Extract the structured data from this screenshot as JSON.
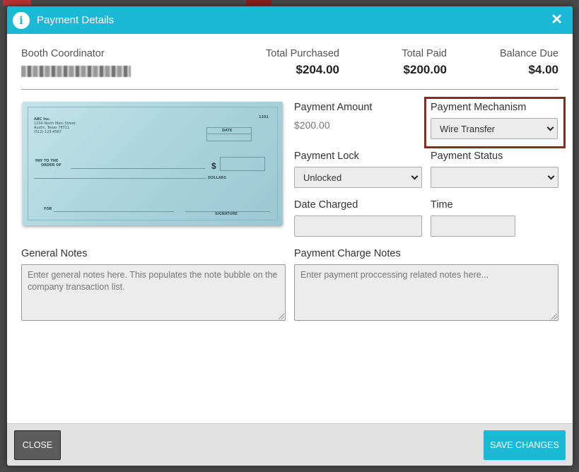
{
  "modal": {
    "title": "Payment Details",
    "close_glyph": "✕"
  },
  "summary": {
    "booth_coordinator_label": "Booth Coordinator",
    "total_purchased_label": "Total Purchased",
    "total_purchased_value": "$204.00",
    "total_paid_label": "Total Paid",
    "total_paid_value": "$200.00",
    "balance_due_label": "Balance Due",
    "balance_due_value": "$4.00"
  },
  "check": {
    "company": "ABC Inc.",
    "address1": "1234 North Main Street",
    "address2": "Austin, Texas 78711",
    "phone": "(512) 123-4567",
    "number": "1201",
    "date_label": "DATE",
    "pay_to_label1": "PAY TO THE",
    "pay_to_label2": "ORDER OF",
    "dollar_sign": "$",
    "dollars_label": "DOLLARS",
    "for_label": "FOR",
    "signature_label": "SIGNATURE"
  },
  "form": {
    "payment_amount_label": "Payment Amount",
    "payment_amount_value": "$200.00",
    "payment_mechanism_label": "Payment Mechanism",
    "payment_mechanism_value": "Wire Transfer",
    "payment_lock_label": "Payment Lock",
    "payment_lock_value": "Unlocked",
    "payment_status_label": "Payment Status",
    "payment_status_value": "",
    "date_charged_label": "Date Charged",
    "date_charged_value": "",
    "time_label": "Time",
    "time_value": ""
  },
  "notes": {
    "general_label": "General Notes",
    "general_placeholder": "Enter general notes here.  This populates the note bubble on the company transaction list.",
    "charge_label": "Payment Charge Notes",
    "charge_placeholder": "Enter payment proccessing related notes here..."
  },
  "footer": {
    "close_label": "CLOSE",
    "save_label": "SAVE CHANGES"
  },
  "colors": {
    "header": "#1bb9d6",
    "highlight_border": "#8b2a1e",
    "save_button": "#1bb9d6",
    "close_button": "#5c5c5c"
  },
  "icons": {
    "info": "info-icon",
    "close": "close-icon",
    "dropdown": "chevron-down-icon"
  }
}
